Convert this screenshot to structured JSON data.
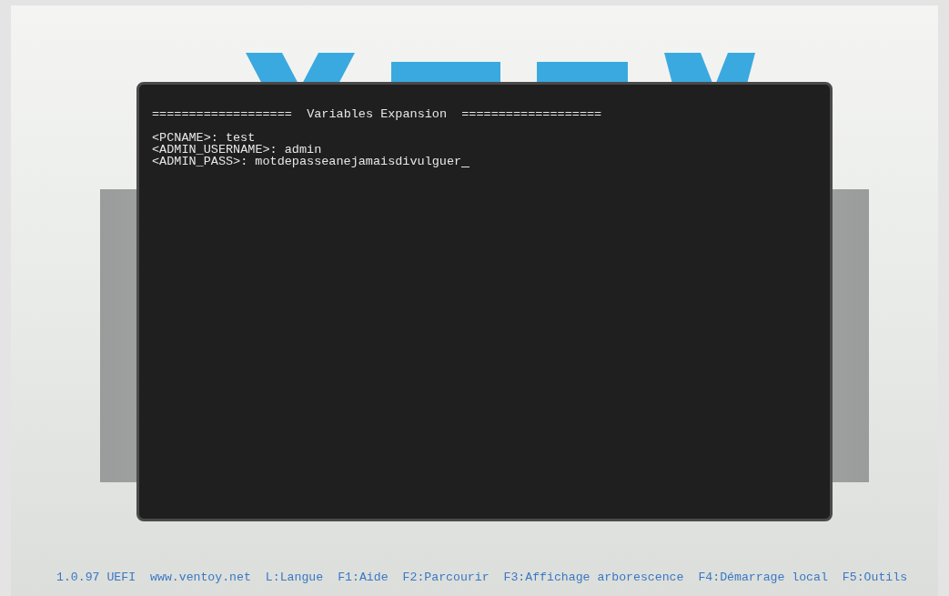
{
  "terminal": {
    "title": "===================  Variables Expansion  ===================",
    "lines": [
      {
        "label": "<PCNAME>:",
        "value": "test",
        "active": false
      },
      {
        "label": "<ADMIN_USERNAME>:",
        "value": "admin",
        "active": false
      },
      {
        "label": "<ADMIN_PASS>:",
        "value": "motdepasseanejamaisdivulguer",
        "active": true
      }
    ]
  },
  "footer": [
    "1.0.97 UEFI",
    "www.ventoy.net",
    "L:Langue",
    "F1:Aide",
    "F2:Parcourir",
    "F3:Affichage arborescence",
    "F4:Démarrage local",
    "F5:Outils"
  ]
}
